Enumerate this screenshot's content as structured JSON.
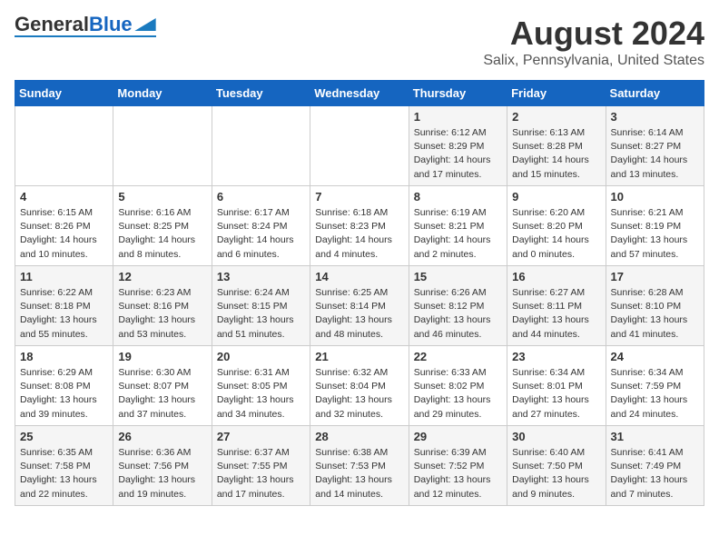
{
  "header": {
    "logo_general": "General",
    "logo_blue": "Blue",
    "main_title": "August 2024",
    "subtitle": "Salix, Pennsylvania, United States"
  },
  "days_of_week": [
    "Sunday",
    "Monday",
    "Tuesday",
    "Wednesday",
    "Thursday",
    "Friday",
    "Saturday"
  ],
  "weeks": [
    [
      {
        "day": "",
        "sunrise": "",
        "sunset": "",
        "daylight": ""
      },
      {
        "day": "",
        "sunrise": "",
        "sunset": "",
        "daylight": ""
      },
      {
        "day": "",
        "sunrise": "",
        "sunset": "",
        "daylight": ""
      },
      {
        "day": "",
        "sunrise": "",
        "sunset": "",
        "daylight": ""
      },
      {
        "day": "1",
        "sunrise": "Sunrise: 6:12 AM",
        "sunset": "Sunset: 8:29 PM",
        "daylight": "Daylight: 14 hours and 17 minutes."
      },
      {
        "day": "2",
        "sunrise": "Sunrise: 6:13 AM",
        "sunset": "Sunset: 8:28 PM",
        "daylight": "Daylight: 14 hours and 15 minutes."
      },
      {
        "day": "3",
        "sunrise": "Sunrise: 6:14 AM",
        "sunset": "Sunset: 8:27 PM",
        "daylight": "Daylight: 14 hours and 13 minutes."
      }
    ],
    [
      {
        "day": "4",
        "sunrise": "Sunrise: 6:15 AM",
        "sunset": "Sunset: 8:26 PM",
        "daylight": "Daylight: 14 hours and 10 minutes."
      },
      {
        "day": "5",
        "sunrise": "Sunrise: 6:16 AM",
        "sunset": "Sunset: 8:25 PM",
        "daylight": "Daylight: 14 hours and 8 minutes."
      },
      {
        "day": "6",
        "sunrise": "Sunrise: 6:17 AM",
        "sunset": "Sunset: 8:24 PM",
        "daylight": "Daylight: 14 hours and 6 minutes."
      },
      {
        "day": "7",
        "sunrise": "Sunrise: 6:18 AM",
        "sunset": "Sunset: 8:23 PM",
        "daylight": "Daylight: 14 hours and 4 minutes."
      },
      {
        "day": "8",
        "sunrise": "Sunrise: 6:19 AM",
        "sunset": "Sunset: 8:21 PM",
        "daylight": "Daylight: 14 hours and 2 minutes."
      },
      {
        "day": "9",
        "sunrise": "Sunrise: 6:20 AM",
        "sunset": "Sunset: 8:20 PM",
        "daylight": "Daylight: 14 hours and 0 minutes."
      },
      {
        "day": "10",
        "sunrise": "Sunrise: 6:21 AM",
        "sunset": "Sunset: 8:19 PM",
        "daylight": "Daylight: 13 hours and 57 minutes."
      }
    ],
    [
      {
        "day": "11",
        "sunrise": "Sunrise: 6:22 AM",
        "sunset": "Sunset: 8:18 PM",
        "daylight": "Daylight: 13 hours and 55 minutes."
      },
      {
        "day": "12",
        "sunrise": "Sunrise: 6:23 AM",
        "sunset": "Sunset: 8:16 PM",
        "daylight": "Daylight: 13 hours and 53 minutes."
      },
      {
        "day": "13",
        "sunrise": "Sunrise: 6:24 AM",
        "sunset": "Sunset: 8:15 PM",
        "daylight": "Daylight: 13 hours and 51 minutes."
      },
      {
        "day": "14",
        "sunrise": "Sunrise: 6:25 AM",
        "sunset": "Sunset: 8:14 PM",
        "daylight": "Daylight: 13 hours and 48 minutes."
      },
      {
        "day": "15",
        "sunrise": "Sunrise: 6:26 AM",
        "sunset": "Sunset: 8:12 PM",
        "daylight": "Daylight: 13 hours and 46 minutes."
      },
      {
        "day": "16",
        "sunrise": "Sunrise: 6:27 AM",
        "sunset": "Sunset: 8:11 PM",
        "daylight": "Daylight: 13 hours and 44 minutes."
      },
      {
        "day": "17",
        "sunrise": "Sunrise: 6:28 AM",
        "sunset": "Sunset: 8:10 PM",
        "daylight": "Daylight: 13 hours and 41 minutes."
      }
    ],
    [
      {
        "day": "18",
        "sunrise": "Sunrise: 6:29 AM",
        "sunset": "Sunset: 8:08 PM",
        "daylight": "Daylight: 13 hours and 39 minutes."
      },
      {
        "day": "19",
        "sunrise": "Sunrise: 6:30 AM",
        "sunset": "Sunset: 8:07 PM",
        "daylight": "Daylight: 13 hours and 37 minutes."
      },
      {
        "day": "20",
        "sunrise": "Sunrise: 6:31 AM",
        "sunset": "Sunset: 8:05 PM",
        "daylight": "Daylight: 13 hours and 34 minutes."
      },
      {
        "day": "21",
        "sunrise": "Sunrise: 6:32 AM",
        "sunset": "Sunset: 8:04 PM",
        "daylight": "Daylight: 13 hours and 32 minutes."
      },
      {
        "day": "22",
        "sunrise": "Sunrise: 6:33 AM",
        "sunset": "Sunset: 8:02 PM",
        "daylight": "Daylight: 13 hours and 29 minutes."
      },
      {
        "day": "23",
        "sunrise": "Sunrise: 6:34 AM",
        "sunset": "Sunset: 8:01 PM",
        "daylight": "Daylight: 13 hours and 27 minutes."
      },
      {
        "day": "24",
        "sunrise": "Sunrise: 6:34 AM",
        "sunset": "Sunset: 7:59 PM",
        "daylight": "Daylight: 13 hours and 24 minutes."
      }
    ],
    [
      {
        "day": "25",
        "sunrise": "Sunrise: 6:35 AM",
        "sunset": "Sunset: 7:58 PM",
        "daylight": "Daylight: 13 hours and 22 minutes."
      },
      {
        "day": "26",
        "sunrise": "Sunrise: 6:36 AM",
        "sunset": "Sunset: 7:56 PM",
        "daylight": "Daylight: 13 hours and 19 minutes."
      },
      {
        "day": "27",
        "sunrise": "Sunrise: 6:37 AM",
        "sunset": "Sunset: 7:55 PM",
        "daylight": "Daylight: 13 hours and 17 minutes."
      },
      {
        "day": "28",
        "sunrise": "Sunrise: 6:38 AM",
        "sunset": "Sunset: 7:53 PM",
        "daylight": "Daylight: 13 hours and 14 minutes."
      },
      {
        "day": "29",
        "sunrise": "Sunrise: 6:39 AM",
        "sunset": "Sunset: 7:52 PM",
        "daylight": "Daylight: 13 hours and 12 minutes."
      },
      {
        "day": "30",
        "sunrise": "Sunrise: 6:40 AM",
        "sunset": "Sunset: 7:50 PM",
        "daylight": "Daylight: 13 hours and 9 minutes."
      },
      {
        "day": "31",
        "sunrise": "Sunrise: 6:41 AM",
        "sunset": "Sunset: 7:49 PM",
        "daylight": "Daylight: 13 hours and 7 minutes."
      }
    ]
  ]
}
